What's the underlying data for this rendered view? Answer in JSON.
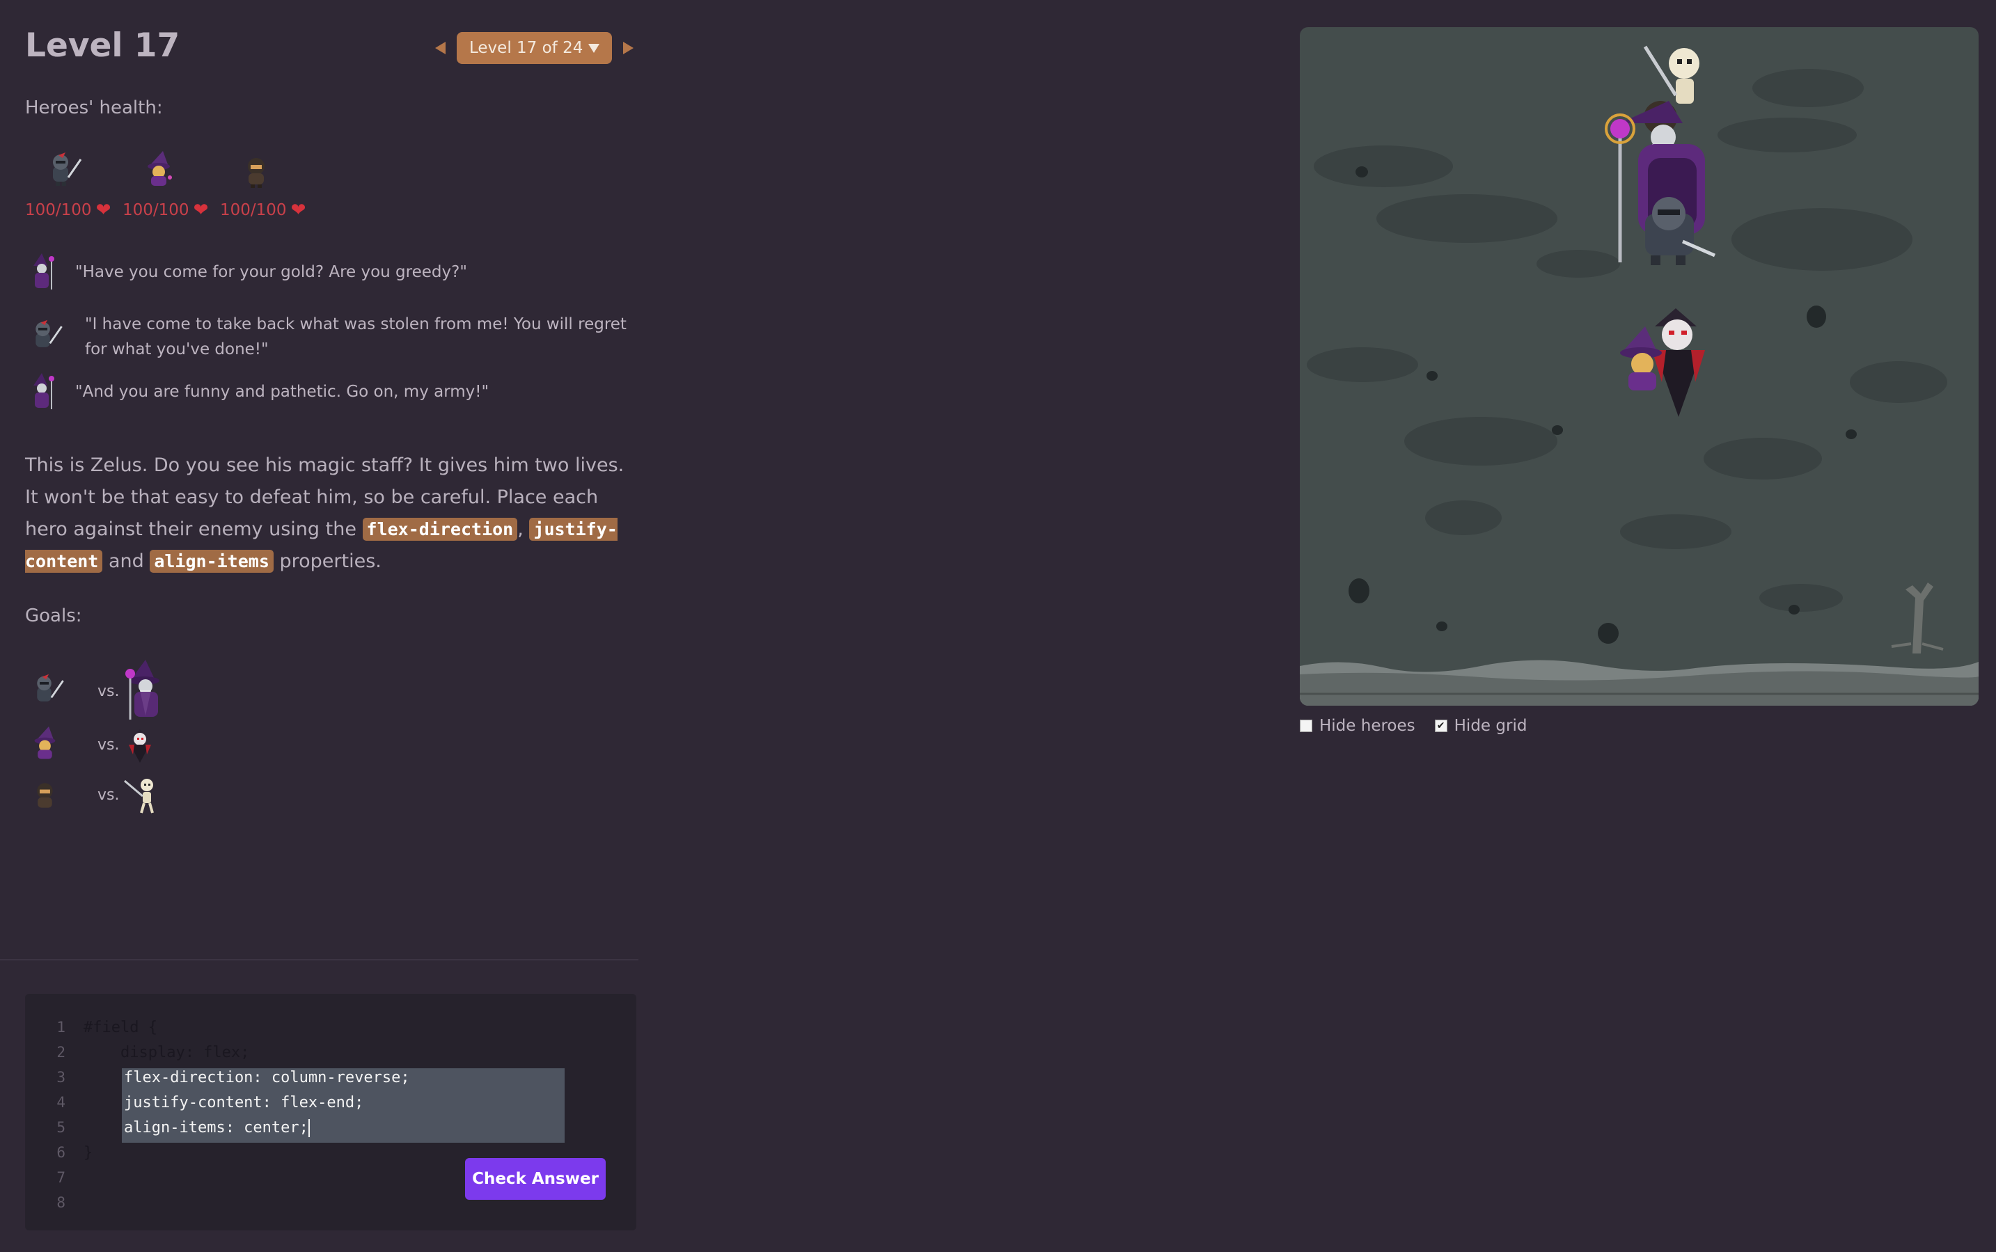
{
  "header": {
    "title": "Level 17",
    "level_selector": "Level 17 of 24"
  },
  "health": {
    "label": "Heroes' health:",
    "heroes": [
      {
        "name": "knight",
        "health": "100/100"
      },
      {
        "name": "wizard",
        "health": "100/100"
      },
      {
        "name": "rogue",
        "health": "100/100"
      }
    ]
  },
  "dialogue": [
    {
      "speaker": "zelus",
      "text": "\"Have you come for your gold? Are you greedy?\""
    },
    {
      "speaker": "knight",
      "text": "\"I have come to take back what was stolen from me! You will regret for what you've done!\""
    },
    {
      "speaker": "zelus",
      "text": "\"And you are funny and pathetic. Go on, my army!\""
    }
  ],
  "instructions": {
    "part1": "This is Zelus. Do you see his magic staff? It gives him two lives. It won't be that easy to defeat him, so be careful. Place each hero against their enemy using the ",
    "code1": "flex-direction",
    "part2": ", ",
    "code2": "justify-content",
    "part3": " and ",
    "code3": "align-items",
    "part4": " properties."
  },
  "goals": {
    "label": "Goals:",
    "vs_label": "vs.",
    "pairs": [
      {
        "hero": "knight",
        "enemy": "zelus"
      },
      {
        "hero": "wizard",
        "enemy": "vampire"
      },
      {
        "hero": "rogue",
        "enemy": "skeleton"
      }
    ]
  },
  "editor": {
    "line_numbers": [
      "1",
      "2",
      "3",
      "4",
      "5",
      "6",
      "7",
      "8"
    ],
    "line1": "#field {",
    "line2": "    display: flex;",
    "input_lines": [
      "flex-direction: column-reverse;",
      "justify-content: flex-end;",
      "align-items: center;"
    ],
    "line6": "}",
    "check_button": "Check Answer"
  },
  "board": {
    "options": [
      {
        "label": "Hide heroes",
        "checked": false
      },
      {
        "label": "Hide grid",
        "checked": true
      }
    ]
  },
  "colors": {
    "background": "#2f2835",
    "accent": "#b5774a",
    "button": "#7c3aed",
    "health": "#c9404a",
    "board": "#444d4c"
  }
}
